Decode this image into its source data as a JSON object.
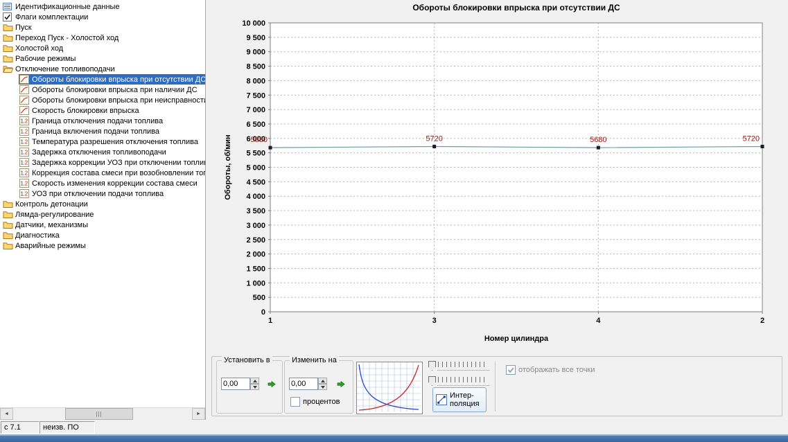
{
  "tree": {
    "items": [
      {
        "label": "Идентификационные данные",
        "icon": "id-data",
        "level": 0,
        "selected": false
      },
      {
        "label": "Флаги комплектации",
        "icon": "flags",
        "level": 0,
        "selected": false
      },
      {
        "label": "Пуск",
        "icon": "folder",
        "level": 0,
        "selected": false
      },
      {
        "label": "Переход Пуск - Холостой ход",
        "icon": "folder",
        "level": 0,
        "selected": false
      },
      {
        "label": "Холостой ход",
        "icon": "folder",
        "level": 0,
        "selected": false
      },
      {
        "label": "Рабочие режимы",
        "icon": "folder",
        "level": 0,
        "selected": false
      },
      {
        "label": "Отключение топливоподачи",
        "icon": "folder-open",
        "level": 0,
        "selected": false
      },
      {
        "label": "Обороты блокировки впрыска при отсутствии ДС",
        "icon": "curve",
        "level": 1,
        "selected": true
      },
      {
        "label": "Обороты блокировки впрыска при наличии ДС",
        "icon": "curve",
        "level": 1,
        "selected": false
      },
      {
        "label": "Обороты блокировки впрыска при неисправности",
        "icon": "curve",
        "level": 1,
        "selected": false
      },
      {
        "label": "Скорость блокировки впрыска",
        "icon": "curve",
        "level": 1,
        "selected": false
      },
      {
        "label": "Граница отключения подачи топлива",
        "icon": "value",
        "level": 1,
        "selected": false
      },
      {
        "label": "Граница включения подачи топлива",
        "icon": "value",
        "level": 1,
        "selected": false
      },
      {
        "label": "Температура разрешения отключения топлива",
        "icon": "value",
        "level": 1,
        "selected": false
      },
      {
        "label": "Задержка отключения топливоподачи",
        "icon": "value",
        "level": 1,
        "selected": false
      },
      {
        "label": "Задержка коррекции УОЗ при отключении топлив",
        "icon": "value",
        "level": 1,
        "selected": false
      },
      {
        "label": "Коррекция состава смеси при возобновлении топ",
        "icon": "value",
        "level": 1,
        "selected": false
      },
      {
        "label": "Скорость изменения коррекции состава смеси",
        "icon": "value",
        "level": 1,
        "selected": false
      },
      {
        "label": "УОЗ при отключении подачи топлива",
        "icon": "value",
        "level": 1,
        "selected": false
      },
      {
        "label": "Контроль детонации",
        "icon": "folder",
        "level": 0,
        "selected": false
      },
      {
        "label": "Лямда-регулирование",
        "icon": "folder",
        "level": 0,
        "selected": false
      },
      {
        "label": "Датчики, механизмы",
        "icon": "folder",
        "level": 0,
        "selected": false
      },
      {
        "label": "Диагностика",
        "icon": "folder",
        "level": 0,
        "selected": false
      },
      {
        "label": "Аварийные режимы",
        "icon": "folder",
        "level": 0,
        "selected": false
      }
    ]
  },
  "chart_data": {
    "type": "line",
    "title": "Обороты блокировки впрыска при отсутствии ДС",
    "xlabel": "Номер цилиндра",
    "ylabel": "Обороты, об/мин",
    "categories": [
      "1",
      "3",
      "4",
      "2"
    ],
    "values": [
      5680,
      5720,
      5680,
      5720
    ],
    "ylim": [
      0,
      10000
    ],
    "ytick_step": 500,
    "grid": true,
    "legend": "none",
    "line_color": "#6b9aab",
    "point_color": "#1a1a33",
    "label_color": "#8b1a1a"
  },
  "controls": {
    "set_group": {
      "label": "Установить в",
      "value": "0,00"
    },
    "change_group": {
      "label": "Изменить на",
      "value": "0,00",
      "percent_label": "процентов"
    },
    "interpolation_button": {
      "label": "Интер-поляция"
    },
    "show_all_points": {
      "label": "отображать все точки",
      "checked": true
    }
  },
  "statusbar": {
    "segments": [
      "с 7.1",
      "неизв. ПО"
    ]
  }
}
